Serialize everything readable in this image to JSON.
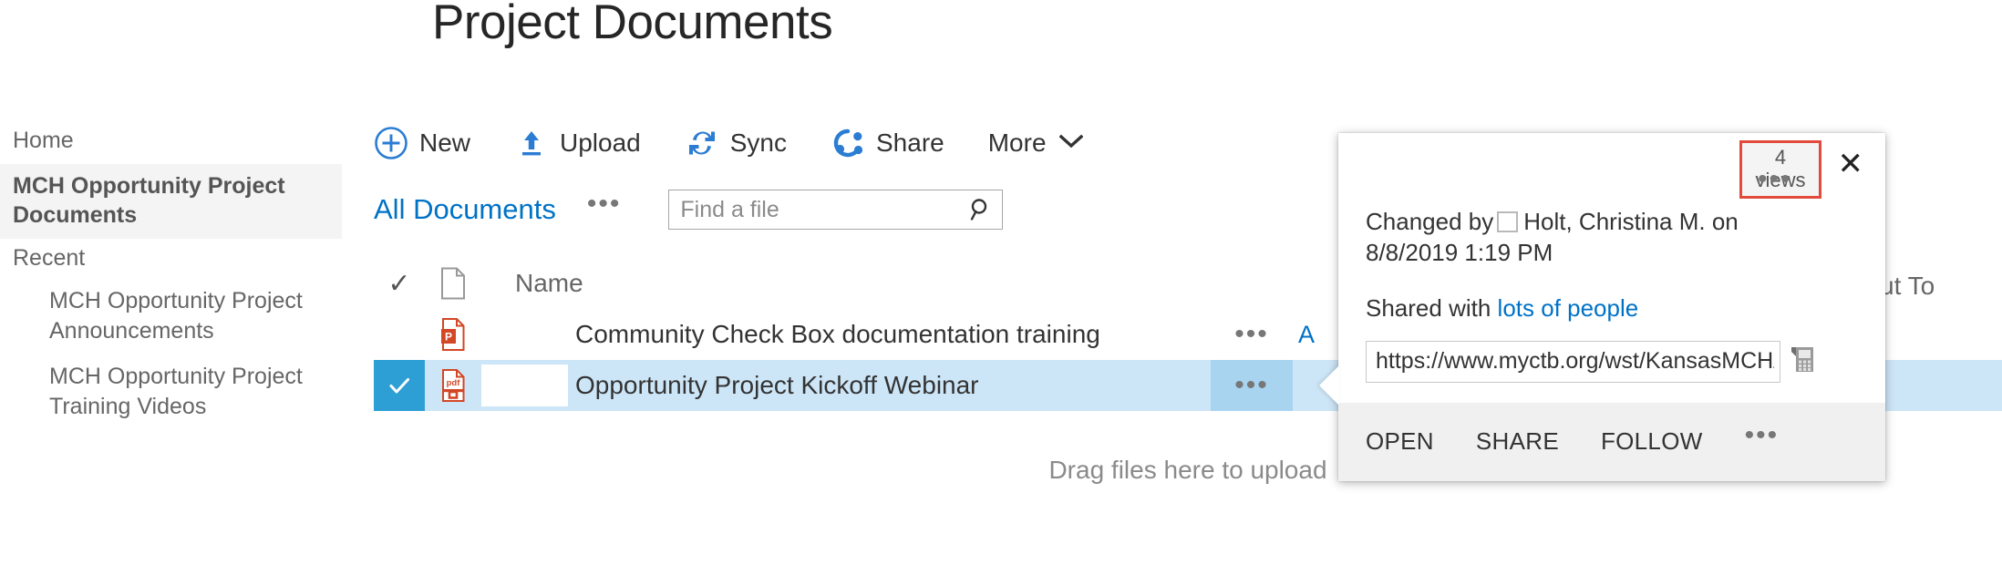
{
  "page": {
    "title": "Project Documents"
  },
  "sidebar": {
    "home_label": "Home",
    "active_item": "MCH Opportunity Project Documents",
    "recent_heading": "Recent",
    "recent_items": [
      {
        "label": "MCH Opportunity Project Announcements"
      },
      {
        "label": "MCH Opportunity Project Training Videos"
      }
    ]
  },
  "toolbar": {
    "new_label": "New",
    "upload_label": "Upload",
    "sync_label": "Sync",
    "share_label": "Share",
    "more_label": "More",
    "new_icon": "plus-circle-icon",
    "upload_icon": "upload-arrow-icon",
    "sync_icon": "sync-refresh-icon",
    "share_icon": "share-nodes-icon",
    "more_icon": "chevron-down-icon",
    "accent_color": "#2b7cd3"
  },
  "view_bar": {
    "view_name": "All Documents",
    "view_ellipsis": "•••",
    "search_placeholder": "Find a file",
    "search_value": "",
    "search_icon": "search-icon",
    "link_color": "#0072c6"
  },
  "list": {
    "columns": {
      "check": "✓",
      "type_icon": "document-type-icon",
      "name": "Name",
      "checked_out_to_clipped": "ut To"
    },
    "rows": [
      {
        "file_icon": "powerpoint-file-icon",
        "name": "Community Check Box documentation training",
        "ellipsis": "•••",
        "modified_clipped": "A",
        "selected": false
      },
      {
        "file_icon": "pdf-file-icon",
        "name": "Opportunity Project Kickoff Webinar",
        "ellipsis": "•••",
        "selected": true,
        "check": "✓"
      }
    ],
    "drag_hint": "Drag files here to upload",
    "selected_row_bg": "#cde6f7",
    "selected_check_bg": "#2e9fd4"
  },
  "callout": {
    "views_count": "4",
    "views_label": "views",
    "views_highlight_color": "#e24b3c",
    "ellipsis": "•••",
    "close_label": "✕",
    "changed_prefix": "Changed by",
    "changed_by": "Holt, Christina M. on",
    "changed_date": "8/8/2019 1:19 PM",
    "shared_prefix": "Shared with",
    "shared_link": "lots of people",
    "url_value": "https://www.myctb.org/wst/KansasMCH/",
    "copy_icon": "copy-link-icon",
    "actions": [
      {
        "label": "OPEN"
      },
      {
        "label": "SHARE"
      },
      {
        "label": "FOLLOW"
      }
    ],
    "footer_ellipsis": "•••"
  }
}
